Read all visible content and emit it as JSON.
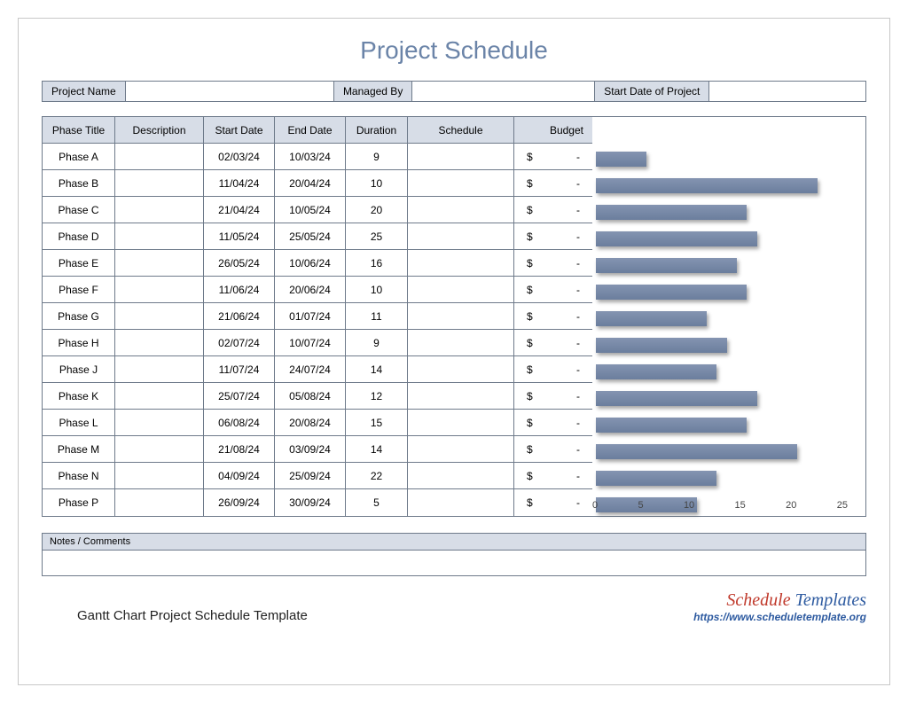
{
  "title": "Project Schedule",
  "meta": {
    "project_name_label": "Project Name",
    "project_name_value": "",
    "managed_by_label": "Managed By",
    "managed_by_value": "",
    "start_date_label": "Start Date of Project",
    "start_date_value": ""
  },
  "columns": {
    "phase": "Phase Title",
    "desc": "Description",
    "start": "Start Date",
    "end": "End Date",
    "dur": "Duration",
    "sched": "Schedule",
    "budget": "Budget"
  },
  "budget_symbol": "$",
  "budget_dash": "-",
  "rows": [
    {
      "phase": "Phase A",
      "desc": "",
      "start": "02/03/24",
      "end": "10/03/24",
      "dur": "9",
      "sched": ""
    },
    {
      "phase": "Phase B",
      "desc": "",
      "start": "11/04/24",
      "end": "20/04/24",
      "dur": "10",
      "sched": ""
    },
    {
      "phase": "Phase C",
      "desc": "",
      "start": "21/04/24",
      "end": "10/05/24",
      "dur": "20",
      "sched": ""
    },
    {
      "phase": "Phase D",
      "desc": "",
      "start": "11/05/24",
      "end": "25/05/24",
      "dur": "25",
      "sched": ""
    },
    {
      "phase": "Phase E",
      "desc": "",
      "start": "26/05/24",
      "end": "10/06/24",
      "dur": "16",
      "sched": ""
    },
    {
      "phase": "Phase F",
      "desc": "",
      "start": "11/06/24",
      "end": "20/06/24",
      "dur": "10",
      "sched": ""
    },
    {
      "phase": "Phase G",
      "desc": "",
      "start": "21/06/24",
      "end": "01/07/24",
      "dur": "11",
      "sched": ""
    },
    {
      "phase": "Phase H",
      "desc": "",
      "start": "02/07/24",
      "end": "10/07/24",
      "dur": "9",
      "sched": ""
    },
    {
      "phase": "Phase J",
      "desc": "",
      "start": "11/07/24",
      "end": "24/07/24",
      "dur": "14",
      "sched": ""
    },
    {
      "phase": "Phase K",
      "desc": "",
      "start": "25/07/24",
      "end": "05/08/24",
      "dur": "12",
      "sched": ""
    },
    {
      "phase": "Phase L",
      "desc": "",
      "start": "06/08/24",
      "end": "20/08/24",
      "dur": "15",
      "sched": ""
    },
    {
      "phase": "Phase M",
      "desc": "",
      "start": "21/08/24",
      "end": "03/09/24",
      "dur": "14",
      "sched": ""
    },
    {
      "phase": "Phase N",
      "desc": "",
      "start": "04/09/24",
      "end": "25/09/24",
      "dur": "22",
      "sched": ""
    },
    {
      "phase": "Phase P",
      "desc": "",
      "start": "26/09/24",
      "end": "30/09/24",
      "dur": "5",
      "sched": ""
    }
  ],
  "chart_data": {
    "type": "bar",
    "orientation": "horizontal",
    "categories": [
      "Phase A",
      "Phase B",
      "Phase C",
      "Phase D",
      "Phase E",
      "Phase F",
      "Phase G",
      "Phase H",
      "Phase J",
      "Phase K",
      "Phase L",
      "Phase M",
      "Phase N",
      "Phase P"
    ],
    "values": [
      5,
      22,
      15,
      16,
      14,
      15,
      11,
      13,
      12,
      16,
      15,
      20,
      12,
      10
    ],
    "xlim": [
      0,
      25
    ],
    "ticks": [
      0,
      5,
      10,
      15,
      20,
      25
    ],
    "xlabel": "",
    "ylabel": "",
    "title": ""
  },
  "notes_label": "Notes / Comments",
  "notes_value": "",
  "caption": "Gantt Chart Project Schedule Template",
  "brand": {
    "word1": "Schedule",
    "word2": "Templates",
    "url": "https://www.scheduletemplate.org"
  }
}
